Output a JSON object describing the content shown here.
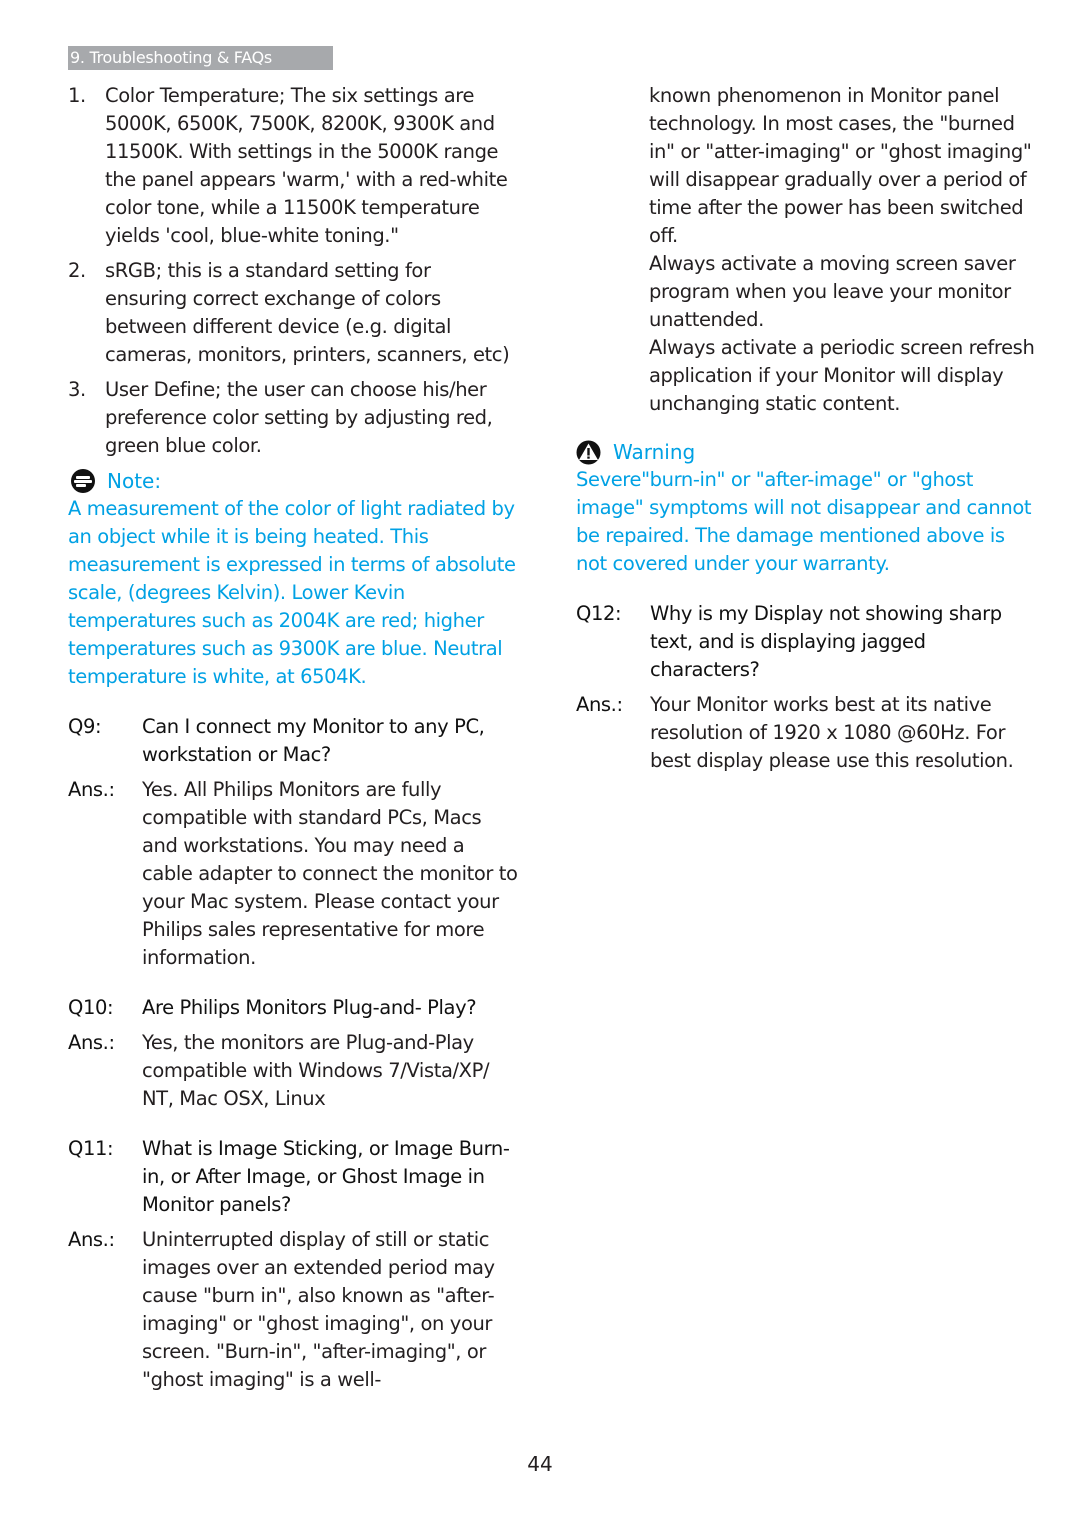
{
  "header": {
    "section_title": "9. Troubleshooting & FAQs"
  },
  "left_column": {
    "numbered_items": [
      {
        "num": "1.",
        "text": "Color Temperature; The six settings are 5000K, 6500K, 7500K, 8200K, 9300K and 11500K. With settings in the 5000K range the panel appears 'warm,' with a red-white color tone, while a 11500K temperature yields 'cool, blue-white toning.\""
      },
      {
        "num": "2.",
        "text": "sRGB; this is a standard setting for ensuring correct exchange of colors between different device (e.g. digital cameras, monitors, printers, scanners, etc)"
      },
      {
        "num": "3.",
        "text": "User Define; the user can choose his/her preference color setting by adjusting red, green blue color."
      }
    ],
    "note": {
      "icon": "note-icon",
      "label": "Note:",
      "text": "A measurement of the color of light radiated by an object while it is being heated. This measurement is expressed in terms of absolute scale, (degrees Kelvin). Lower Kevin temperatures such as 2004K are red; higher temperatures such as 9300K are blue. Neutral temperature is white, at 6504K."
    },
    "faqs": [
      {
        "q_label": "Q9:",
        "question": "Can I connect my Monitor to any PC, workstation or Mac?",
        "a_label": "Ans.:",
        "answer": "Yes. All Philips Monitors are fully compatible with standard PCs, Macs and workstations. You may need a cable adapter to connect the monitor to your Mac system. Please contact your Philips sales representative for more information."
      },
      {
        "q_label": "Q10:",
        "question": "Are Philips Monitors Plug-and- Play?",
        "a_label": "Ans.:",
        "answer": "Yes, the monitors are Plug-and-Play compatible with Windows 7/Vista/XP/ NT, Mac OSX, Linux"
      },
      {
        "q_label": "Q11:",
        "question": "What is Image Sticking, or Image Burn-in, or After Image, or Ghost Image in Monitor panels?",
        "a_label": "Ans.:",
        "answer": "Uninterrupted display of still or static images over an extended period may cause \"burn in\", also known as \"after-imaging\" or \"ghost imaging\", on your screen. \"Burn-in\", \"after-imaging\", or \"ghost imaging\" is a well-"
      }
    ]
  },
  "right_column": {
    "continued_paragraphs": [
      "known phenomenon in Monitor panel technology. In most cases, the \"burned in\" or \"atter-imaging\" or \"ghost imaging\" will disappear gradually over a period of time after the power has been switched off.",
      "Always activate a moving screen saver program when you leave your monitor unattended.",
      "Always activate a periodic screen refresh application if your Monitor will display unchanging static content."
    ],
    "warning": {
      "icon": "warning-icon",
      "label": "Warning",
      "text": "Severe\"burn-in\" or \"after-image\" or \"ghost image\" symptoms will not disappear and cannot be repaired. The damage mentioned above is not covered under your warranty."
    },
    "faqs": [
      {
        "q_label": "Q12:",
        "question": "Why is my Display not showing sharp text, and is displaying jagged characters?",
        "a_label": "Ans.:",
        "answer": "Your Monitor works best at its native resolution of 1920 x 1080 @60Hz. For best display please use this resolution."
      }
    ]
  },
  "footer": {
    "page_number": "44"
  },
  "colors": {
    "accent_blue": "#00a1e4",
    "header_gray": "#a7a9ac",
    "text": "#231f20"
  }
}
